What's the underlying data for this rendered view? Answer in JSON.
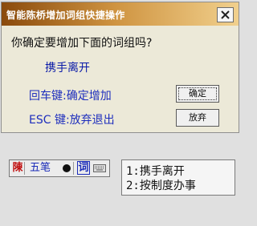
{
  "dialog": {
    "title": "智能陈桥增加词组快捷操作",
    "prompt": "你确定要增加下面的词组吗?",
    "phrase": "携手离开",
    "hint_enter": "回车键:确定增加",
    "hint_esc": "ESC 键:放弃退出",
    "confirm_label": "确定",
    "cancel_label": "放弃"
  },
  "ime_bar": {
    "logo": "陳",
    "name": "五笔",
    "mode_dot": "●",
    "phrase_mode": "词",
    "keyboard_icon": "keyboard-icon"
  },
  "candidates": [
    "1:携手离开",
    "2:按制度办事"
  ],
  "colors": {
    "title_gradient_start": "#8a4a0c",
    "title_gradient_end": "#f1d08d",
    "dialog_bg": "#ece9d8",
    "accent_text": "#1e2ebd"
  }
}
